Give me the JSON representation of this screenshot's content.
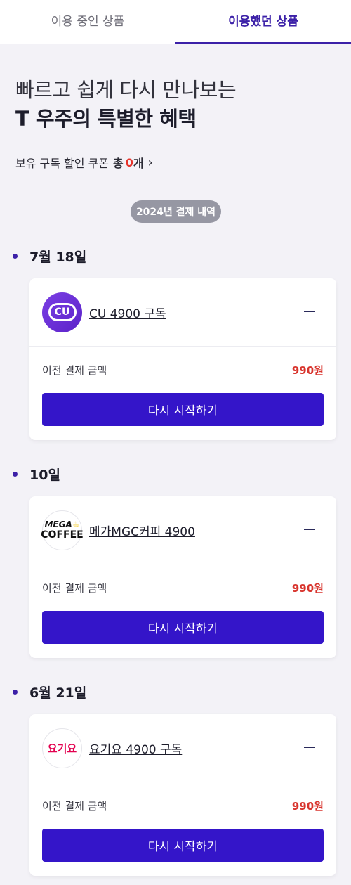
{
  "tabs": [
    {
      "label": "이용 중인 상품",
      "active": false
    },
    {
      "label": "이용했던 상품",
      "active": true
    }
  ],
  "headline": {
    "line1": "빠르고 쉽게 다시 만나보는",
    "line2": "T 우주의 특별한 혜택"
  },
  "coupon": {
    "prefix": "보유 구독 할인 쿠폰",
    "total_label": "총",
    "count": "0",
    "unit": "개",
    "chevron": "›"
  },
  "year_pill": "2024년 결제 내역",
  "entries": [
    {
      "date": "7월 18일",
      "logo_icon": "cu-logo-icon",
      "logo_text": "CU",
      "product": "CU 4900 구독",
      "price_label": "이전 결제 금액",
      "price": "990원",
      "button": "다시 시작하기"
    },
    {
      "date": "10일",
      "logo_icon": "mega-coffee-logo-icon",
      "logo_text_1": "MEGA",
      "logo_text_2": "COFFEE",
      "product": "메가MGC커피 4900",
      "price_label": "이전 결제 금액",
      "price": "990원",
      "button": "다시 시작하기"
    },
    {
      "date": "6월 21일",
      "logo_icon": "yogiyo-logo-icon",
      "logo_text": "요기요",
      "product": "요기요 4900 구독",
      "price_label": "이전 결제 금액",
      "price": "990원",
      "button": "다시 시작하기"
    }
  ],
  "colors": {
    "accent": "#3c21a8",
    "button": "#3415c9",
    "price": "#d8342d",
    "background": "#f3f2f7"
  }
}
